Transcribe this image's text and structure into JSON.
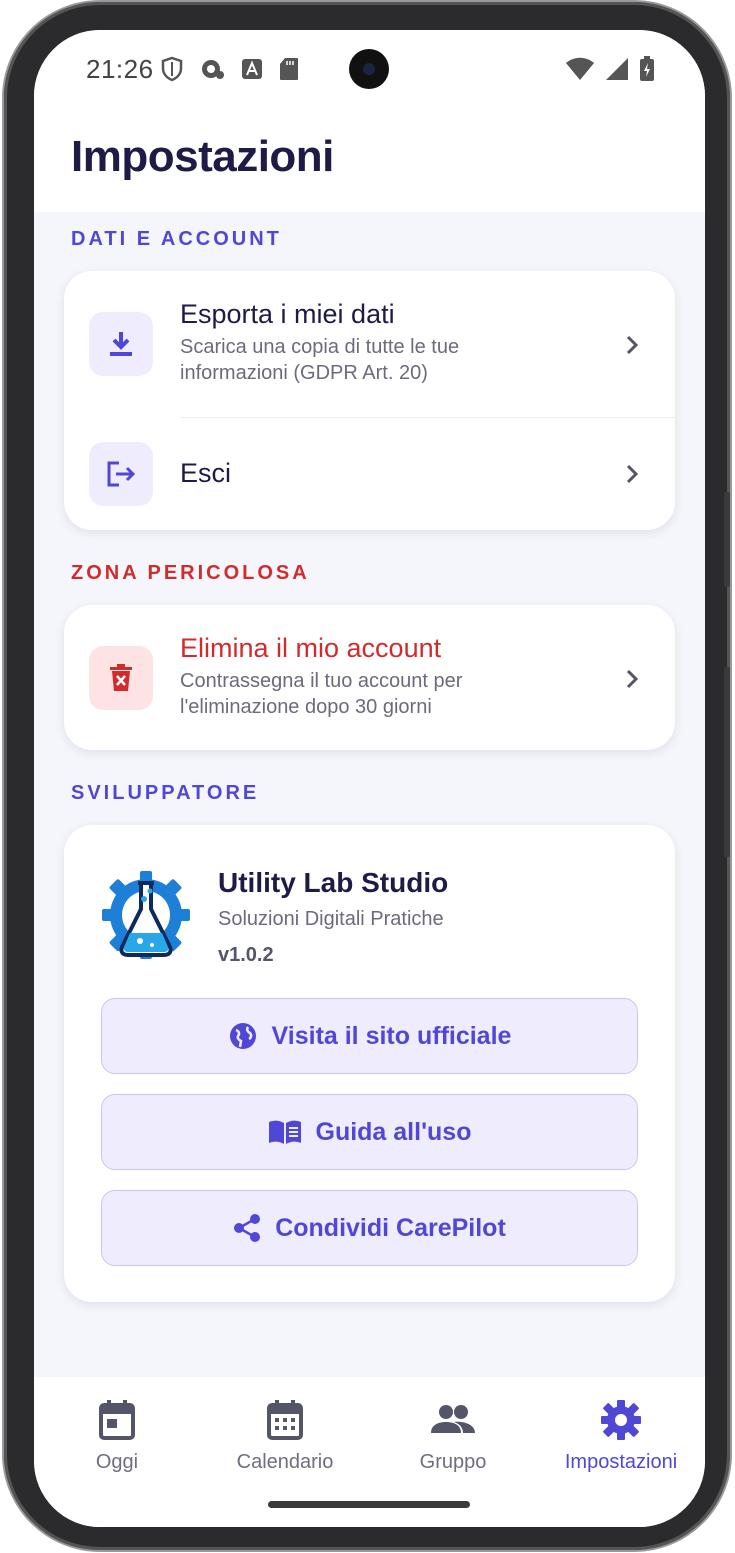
{
  "status_bar": {
    "time": "21:26",
    "icons_left": [
      "shield-icon",
      "cloud-sync-icon",
      "font-a-icon",
      "sd-card-icon"
    ],
    "icons_right": [
      "wifi-icon",
      "signal-icon",
      "battery-charging-icon"
    ]
  },
  "header": {
    "title": "Impostazioni"
  },
  "sections": {
    "account": {
      "label": "DATI E ACCOUNT",
      "export": {
        "title": "Esporta i miei dati",
        "subtitle": "Scarica una copia di tutte le tue informazioni (GDPR Art. 20)",
        "icon": "download-icon"
      },
      "logout": {
        "title": "Esci",
        "icon": "logout-icon"
      }
    },
    "danger": {
      "label": "ZONA PERICOLOSA",
      "delete": {
        "title": "Elimina il mio account",
        "subtitle": "Contrassegna il tuo account per l'eliminazione dopo 30 giorni",
        "icon": "trash-icon"
      }
    },
    "developer": {
      "label": "SVILUPPATORE",
      "name": "Utility Lab Studio",
      "tagline": "Soluzioni Digitali Pratiche",
      "version": "v1.0.2",
      "buttons": [
        {
          "label": "Visita il sito ufficiale",
          "icon": "globe-icon"
        },
        {
          "label": "Guida all'uso",
          "icon": "book-icon"
        },
        {
          "label": "Condividi CarePilot",
          "icon": "share-icon"
        }
      ]
    }
  },
  "nav": {
    "items": [
      {
        "label": "Oggi",
        "icon": "calendar-today-icon",
        "active": false
      },
      {
        "label": "Calendario",
        "icon": "calendar-month-icon",
        "active": false
      },
      {
        "label": "Gruppo",
        "icon": "group-icon",
        "active": false
      },
      {
        "label": "Impostazioni",
        "icon": "gear-icon",
        "active": true
      }
    ]
  },
  "colors": {
    "accent": "#5147d6",
    "danger": "#d22b2b",
    "title": "#1f1b47",
    "background": "#f5f6fb"
  }
}
